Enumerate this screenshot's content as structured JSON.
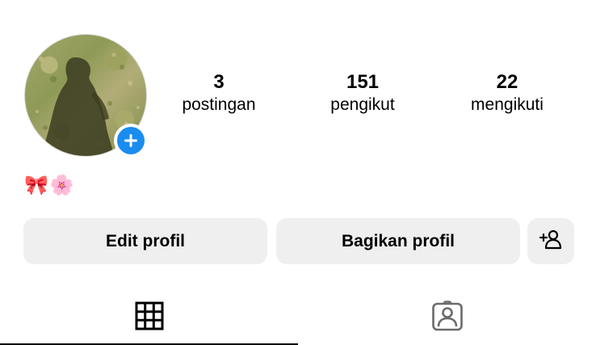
{
  "profile": {
    "avatar_icon": "profile-photo-shadow",
    "add_story_icon": "plus-icon",
    "accent_color": "#1a8cf0"
  },
  "stats": {
    "posts": {
      "value": "3",
      "label": "postingan"
    },
    "followers": {
      "value": "151",
      "label": "pengikut"
    },
    "following": {
      "value": "22",
      "label": "mengikuti"
    }
  },
  "bio": {
    "emoji": "🎀🌸"
  },
  "actions": {
    "edit_label": "Edit profil",
    "share_label": "Bagikan profil",
    "add_friend_icon": "person-add-icon"
  },
  "tabs": [
    {
      "icon": "grid-icon",
      "active": true
    },
    {
      "icon": "tagged-person-icon",
      "active": false
    }
  ]
}
